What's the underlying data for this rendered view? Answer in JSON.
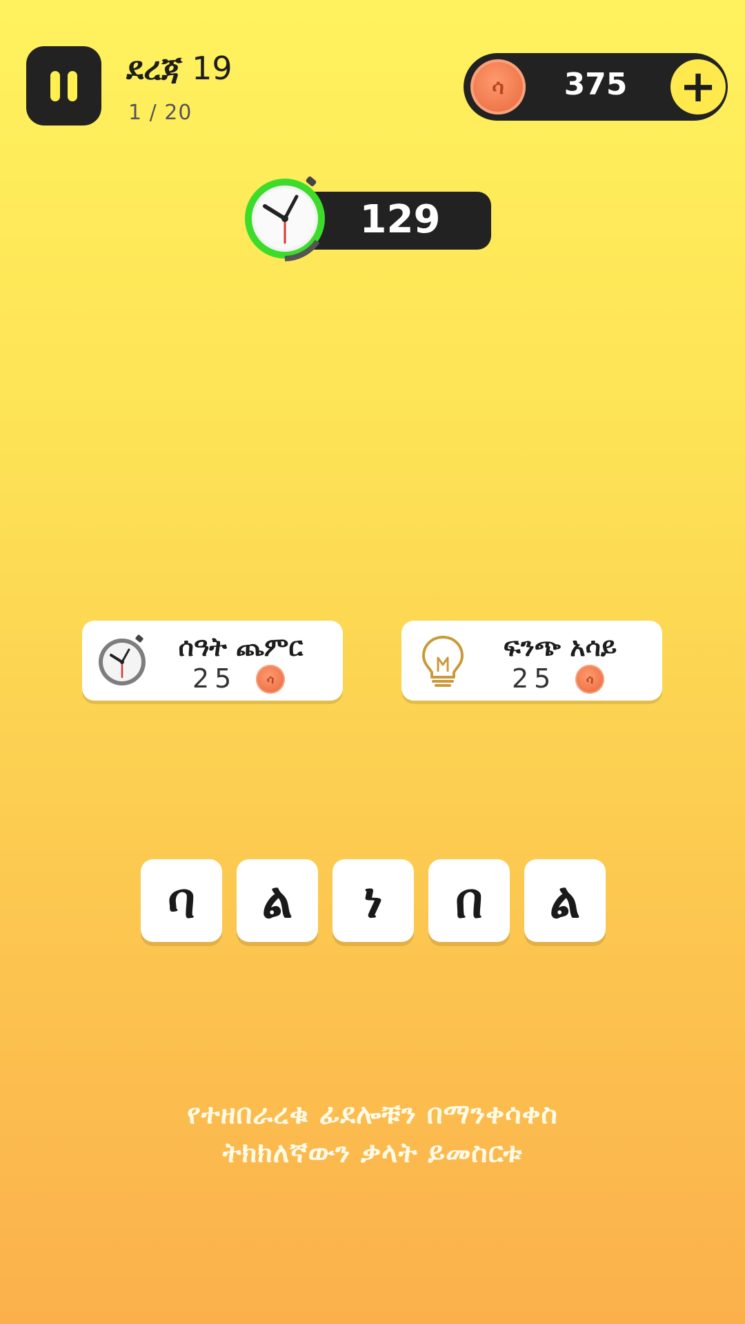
{
  "header": {
    "level_label": "ደረጃ",
    "level_number": "19",
    "progress": "1 / 20",
    "coins": "375",
    "coin_symbol": "ሳ",
    "add_coins_symbol": "+"
  },
  "timer": {
    "value": "129"
  },
  "powerups": [
    {
      "label": "ሰዓት ጨምር",
      "cost": "25",
      "icon": "stopwatch-icon"
    },
    {
      "label": "ፍንጭ አሳይ",
      "cost": "25",
      "icon": "lightbulb-icon"
    }
  ],
  "tiles": [
    "ባ",
    "ል",
    "ነ",
    "በ",
    "ል"
  ],
  "instructions": {
    "line1": "የተዘበራረቁ ፊደሎቹን በማንቀሳቀስ",
    "line2": "ትክክለኛውን ቃላት ይመስርቱ"
  },
  "colors": {
    "background_top": "#fff25e",
    "background_bottom": "#fbb04c",
    "dark_pill": "#222222",
    "coin": "#ee7449",
    "timer_ring": "#3ddc2b"
  }
}
